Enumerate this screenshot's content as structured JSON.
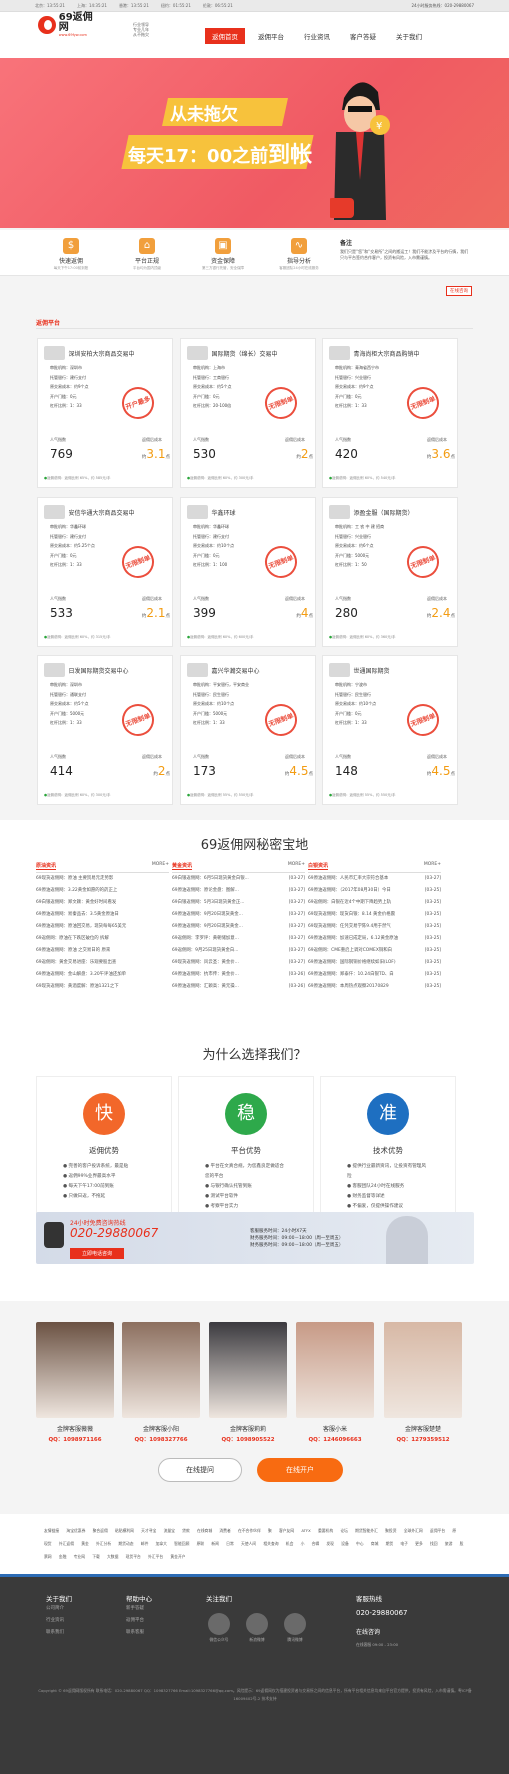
{
  "topbar": {
    "cities": [
      "北京：13:55:21",
      "上海：14:35:21",
      "香港：13:55:21",
      "纽约：01:55:21",
      "伦敦：06:55:21"
    ],
    "phone": "24小时服务热线：020-29880067"
  },
  "header": {
    "logo_name": "69返佣网",
    "logo_url": "www.69fyw.com",
    "slogan": [
      "行业领导",
      "专业几年",
      "从不拖欠"
    ],
    "nav": [
      {
        "label": "返佣首页",
        "active": true
      },
      {
        "label": "返佣平台",
        "active": false
      },
      {
        "label": "行业资讯",
        "active": false
      },
      {
        "label": "客户答疑",
        "active": false
      },
      {
        "label": "关于我们",
        "active": false
      }
    ]
  },
  "banner": {
    "line1": "从未拖欠",
    "line2_prefix": "每天17：00之前",
    "line2_emph": "到帐"
  },
  "features": [
    {
      "icon": "money-bag-icon",
      "glyph": "$",
      "title": "快速返佣",
      "sub": "每天下午17:00前到账"
    },
    {
      "icon": "bank-icon",
      "glyph": "⌂",
      "title": "平台正规",
      "sub": "平台均为国内顶级"
    },
    {
      "icon": "safe-icon",
      "glyph": "▣",
      "title": "资金保障",
      "sub": "第三方银行托管，安全保障"
    },
    {
      "icon": "analysis-icon",
      "glyph": "∿",
      "title": "指导分析",
      "sub": "客服团队24小时在线服务"
    }
  ],
  "notice": {
    "title": "备注",
    "body": "我们只是“您”和“交易所”之间的搬运工！我们不能涉及平台的行情，我们只与平台签约合作客户，投资有风险，入市需谨慎。",
    "button": "在线咨询"
  },
  "platform_section": {
    "title": "返佣平台"
  },
  "row_labels": {
    "org": "审批机构",
    "bank": "托管银行",
    "deposit": "原交易成本",
    "min": "开户门槛",
    "leverage": "杠杆比例",
    "pop": "人气指数",
    "rebate": "返佣后成本",
    "approx": "约",
    "unit": "点",
    "foot_a": "返佣说明：返佣比例",
    "foot_b": "，约",
    "foot_c": "元/手"
  },
  "cards": [
    {
      "name": "深圳安柏大宗商品交易中",
      "org": "深圳市",
      "bank": "建行支付",
      "deposit": "约9个点",
      "min": "0元",
      "leverage": "1：33",
      "stamp": "开户最多",
      "pop": "769",
      "rebate": "3.1",
      "ratio": "65%",
      "per": "585元/手"
    },
    {
      "name": "国际期货（绵长）交易中",
      "org": "上海市",
      "bank": "工商银行",
      "deposit": "约5个点",
      "min": "0元",
      "leverage": "20-100倍",
      "stamp": "无限制单",
      "pop": "530",
      "rebate": "2",
      "ratio": "60%",
      "per": "300元/手"
    },
    {
      "name": "青海尚柜大宗商品购销中",
      "org": "青海省西宁市",
      "bank": "兴业银行",
      "deposit": "约9个点",
      "min": "0元",
      "leverage": "1：33",
      "stamp": "无限制单",
      "pop": "420",
      "rebate": "3.6",
      "ratio": "60%",
      "per": "540元/手"
    },
    {
      "name": "安信华通大宗商品交易中",
      "org": "华鑫环球",
      "bank": "建行支付",
      "deposit": "约5.25个点",
      "min": "0元",
      "leverage": "1：33",
      "stamp": "无限制单",
      "pop": "533",
      "rebate": "2.1",
      "ratio": "60%",
      "per": "315元/手"
    },
    {
      "name": "华鑫环球",
      "org": "华鑫环球",
      "bank": "建行支付",
      "deposit": "约10个点",
      "min": "0元",
      "leverage": "1：100",
      "stamp": "无限制单",
      "pop": "399",
      "rebate": "4",
      "ratio": "60%",
      "per": "600元/手"
    },
    {
      "name": "添盈金服（国际期货）",
      "org": "工 农 中 建 招商",
      "bank": "兴业银行",
      "deposit": "约6个点",
      "min": "5000元",
      "leverage": "1：50",
      "stamp": "无限制单",
      "pop": "280",
      "rebate": "2.4",
      "ratio": "60%",
      "per": "360元/手"
    },
    {
      "name": "日发国际期货交易中心",
      "org": "深圳市",
      "bank": "通联支付",
      "deposit": "约5个点",
      "min": "5000元",
      "leverage": "1：33",
      "stamp": "无限制单",
      "pop": "414",
      "rebate": "2",
      "ratio": "60%",
      "per": "300元/手"
    },
    {
      "name": "嘉兴华瀚交易中心",
      "org": "平安银行，平安商业",
      "bank": "民生银行",
      "deposit": "约10个点",
      "min": "5000元",
      "leverage": "1：33",
      "stamp": "无限制单",
      "pop": "173",
      "rebate": "4.5",
      "ratio": "55%",
      "per": "550元/手"
    },
    {
      "name": "世通国际期货",
      "org": "宁波市",
      "bank": "民生银行",
      "deposit": "约10个点",
      "min": "0元",
      "leverage": "1：33",
      "stamp": "无限制单",
      "pop": "148",
      "rebate": "4.5",
      "ratio": "55%",
      "per": "550元/手"
    }
  ],
  "mishu": {
    "title": "69返佣网秘密宝地",
    "more": "MORE+",
    "columns": [
      {
        "name": "原油资讯",
        "items": [
          {
            "t": "69现货返佣网：原油 主要贸易元走势影",
            "d": ""
          },
          {
            "t": "69原油返佣网：3.22黄金如愿的的药正上",
            "d": ""
          },
          {
            "t": "69白银返佣网：郑文颖：黄金好时间看发",
            "d": ""
          },
          {
            "t": "69原油返佣网：易秦品去：3.5黄金原油日",
            "d": ""
          },
          {
            "t": "69原油返佣网：原油回交易，现货每每65美元",
            "d": ""
          },
          {
            "t": "69返佣网：原油在下跌区破位的 拆解",
            "d": ""
          },
          {
            "t": "69原油返佣网：原油 之交易日的 原来",
            "d": ""
          },
          {
            "t": "69返佣网：黄金交易进座：乐观要股出查",
            "d": ""
          },
          {
            "t": "69原油返佣网：金山解盘：3.20午评油还加单",
            "d": ""
          },
          {
            "t": "69现货返佣网：黄酒度解：原油1321之下",
            "d": ""
          }
        ]
      },
      {
        "name": "黄金资讯",
        "items": [
          {
            "t": "69白银返佣网：6月5日现货黄金白银...",
            "d": "[03-27]"
          },
          {
            "t": "69原油返佣网：原论金盘：图解...",
            "d": "[03-27]"
          },
          {
            "t": "69白银返佣网：5月3日现货黄金正...",
            "d": "[03-27]"
          },
          {
            "t": "69原油返佣网：9月20日现货黄金...",
            "d": "[03-27]"
          },
          {
            "t": "69原油返佣网：9月20日现货黄金...",
            "d": "[03-27]"
          },
          {
            "t": "69返佣网：李罗评：黄朝储加意...",
            "d": "[03-27]"
          },
          {
            "t": "69返佣网：9月25日现货黄金白...",
            "d": "[03-27]"
          },
          {
            "t": "69现货返佣网：风云圣：黄金价...",
            "d": "[03-27]"
          },
          {
            "t": "69原油返佣网：抗市传：黄金价...",
            "d": "[03-26]"
          },
          {
            "t": "69原油返佣网：汇颖高：黄元操...",
            "d": "[03-26]"
          }
        ]
      },
      {
        "name": "白银资讯",
        "items": [
          {
            "t": "69原油返佣网：人民币汇率大宗符合基本",
            "d": "[03-27]"
          },
          {
            "t": "69原油返佣网：（2017年08月30日）今日",
            "d": "[03-25]"
          },
          {
            "t": "69返佣网：白银在近4个中期下降趋势上轨",
            "d": "[03-25]"
          },
          {
            "t": "69现货返佣网：现货白银：8.14 黄金价格震",
            "d": "[03-25]"
          },
          {
            "t": "69现货返佣网：任凭交易学陈9.4用于然气",
            "d": "[03-25]"
          },
          {
            "t": "69原油返佣网：加速已成定局，6.12黄金原油",
            "d": "[03-25]"
          },
          {
            "t": "69返佣网：CME重启上调对COMEX铜和白",
            "d": "[03-25]"
          },
          {
            "t": "69原油返佣网：国际钢铜价格继续如旧(LOF)",
            "d": "[03-25]"
          },
          {
            "t": "69原油返佣网：郑泰仟：10.24白银TD、白",
            "d": "[03-25]"
          },
          {
            "t": "69原油返佣网：本周热点观察20170829",
            "d": "[03-25]"
          }
        ]
      }
    ]
  },
  "why": {
    "title": "为什么选择我们？",
    "boxes": [
      {
        "char": "快",
        "color": "#f2672a",
        "title": "返佣优势",
        "items": [
          "完善的客户投诉系统，最是贴",
          "返佣99%业界最高水平",
          "每天下午17:00前到账",
          "只做日返，不拖延"
        ]
      },
      {
        "char": "稳",
        "color": "#2ea94b",
        "title": "平台优势",
        "items": [
          "平台在文真合规，为您鑫良定做适合您的平台",
          "与银行确认托管到账",
          "测试平台软件",
          "考察平台实力"
        ]
      },
      {
        "char": "准",
        "color": "#1e6fc1",
        "title": "技术优势",
        "items": [
          "提供行业最新资讯，让投资有管理风险",
          "客服团队24小时在线服务",
          "财务监督等详述",
          "不偏爱，仅提供操作建议"
        ]
      }
    ]
  },
  "callbar": {
    "top": "24小时免费咨询热线",
    "number": "020-29880067",
    "button": "立即电话咨询",
    "time1": "客服服务时间：24小时X7天",
    "time2": "财务服务时间：09:00－18:00（周一至周五）",
    "time3": "财务服务时间：09:00－18:00（周一至周五）"
  },
  "agents": [
    {
      "name": "金牌客服薇薇",
      "qq": "QQ：1098971166",
      "tone": "#6b5243"
    },
    {
      "name": "金牌客服小阳",
      "qq": "QQ：1098327766",
      "tone": "#8c6f5f"
    },
    {
      "name": "金牌客服莉莉",
      "qq": "QQ：1098905522",
      "tone": "#3b3a3f"
    },
    {
      "name": "客服小米",
      "qq": "QQ：1246096663",
      "tone": "#c79a86"
    },
    {
      "name": "金牌客服楚楚",
      "qq": "QQ：1279359512",
      "tone": "#d7b8a5"
    }
  ],
  "service_buttons": {
    "online": "在线提问",
    "open": "在线开户"
  },
  "links": "友情链接 淘宝优惠券 聚合返佣 粘贴模利网 天才寻宝 流量宝 贷款 在线商城 消费者 在不合作伙伴 聚 客户友网 ATFX 重要机构 论坛 期货智能外汇 聚投资 全球外汇网 返佣平台 原 现货 外汇返佣 黄金 外汇分析 期货动态 邮件 加拿大 智能回顾 原联 新闻 日常 天使人间 相关查询 机会 小 合辑 发现 设备 中心 商城 期货 电子 更多 找回 旅游 股票网 金融 专业网 下载 大数据 现货平台 外汇平台 黄金开户",
  "footer": {
    "about": {
      "title": "关于我们",
      "items": [
        "公司简介",
        "行业资讯",
        "联系我们"
      ]
    },
    "help": {
      "title": "帮助中心",
      "items": [
        "新手答疑",
        "返佣平台",
        "联系客服"
      ]
    },
    "follow": {
      "title": "关注我们",
      "items": [
        {
          "icon": "wechat-icon",
          "label": "微信公众号"
        },
        {
          "icon": "weibo-icon",
          "label": "新浪微博"
        },
        {
          "icon": "tencent-weibo-icon",
          "label": "腾讯微博"
        }
      ]
    },
    "hotline": {
      "title": "客服热线",
      "phone": "020-29880067",
      "online": "在线咨询",
      "note": "在线客服    09:00 - 23:00"
    },
    "copy": "Copyright © 69返佣网版权所有 联系电话：020-29880067 QQ：1098327766 Email:1098327766@qq.com。风险提示：69返佣网仅为搭建投资者与交易所之间的信息平台，所有平台相关信息均来自平台官方提供，投资有风险，入市需谨慎。粤ICP备16009402号-2 技术支持"
  }
}
